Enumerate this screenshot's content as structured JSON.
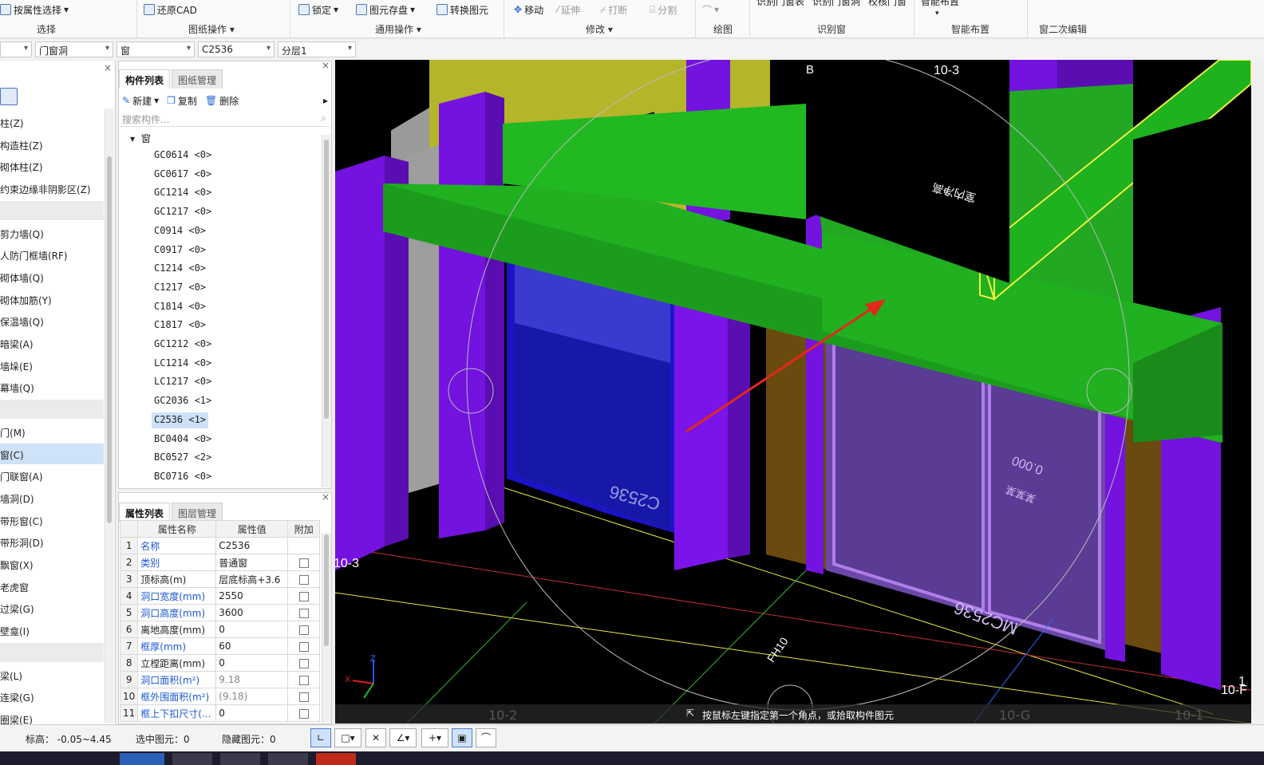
{
  "ribbon": {
    "select": {
      "btn": "按属性选择",
      "label": "选择"
    },
    "drawing_ops": {
      "btn": "还原CAD",
      "label": "图纸操作"
    },
    "common_ops": {
      "lock": "锁定",
      "save": "图元存盘",
      "convert": "转换图元",
      "label": "通用操作"
    },
    "modify": {
      "move": "移动",
      "extend": "延伸",
      "break": "打断",
      "split": "分割",
      "label": "修改"
    },
    "draw": {
      "label": "绘图"
    },
    "recognize": {
      "a": "识别门窗表",
      "b": "识别门窗洞",
      "c": "校核门窗",
      "label": "识别窗"
    },
    "smart": {
      "btn": "智能布置",
      "label": "智能布置"
    },
    "secondary": {
      "label": "窗二次编辑"
    }
  },
  "combos": {
    "c1": "",
    "c2": "门窗洞",
    "c3": "窗",
    "c4": "C2536",
    "c5": "分层1"
  },
  "left_panel": {
    "items": [
      {
        "label": "柱(Z)",
        "sep": false,
        "sel": false
      },
      {
        "label": "构造柱(Z)",
        "sep": false,
        "sel": false
      },
      {
        "label": "砌体柱(Z)",
        "sep": false,
        "sel": false
      },
      {
        "label": "约束边缘非阴影区(Z)",
        "sep": false,
        "sel": false
      },
      {
        "label": "",
        "sep": true,
        "sel": false
      },
      {
        "label": "剪力墙(Q)",
        "sep": false,
        "sel": false
      },
      {
        "label": "人防门框墙(RF)",
        "sep": false,
        "sel": false
      },
      {
        "label": "砌体墙(Q)",
        "sep": false,
        "sel": false
      },
      {
        "label": "砌体加筋(Y)",
        "sep": false,
        "sel": false
      },
      {
        "label": "保温墙(Q)",
        "sep": false,
        "sel": false
      },
      {
        "label": "暗梁(A)",
        "sep": false,
        "sel": false
      },
      {
        "label": "墙垛(E)",
        "sep": false,
        "sel": false
      },
      {
        "label": "幕墙(Q)",
        "sep": false,
        "sel": false
      },
      {
        "label": "",
        "sep": true,
        "sel": false
      },
      {
        "label": "门(M)",
        "sep": false,
        "sel": false
      },
      {
        "label": "窗(C)",
        "sep": false,
        "sel": true
      },
      {
        "label": "门联窗(A)",
        "sep": false,
        "sel": false
      },
      {
        "label": "墙洞(D)",
        "sep": false,
        "sel": false
      },
      {
        "label": "带形窗(C)",
        "sep": false,
        "sel": false
      },
      {
        "label": "带形洞(D)",
        "sep": false,
        "sel": false
      },
      {
        "label": "飘窗(X)",
        "sep": false,
        "sel": false
      },
      {
        "label": "老虎窗",
        "sep": false,
        "sel": false
      },
      {
        "label": "过梁(G)",
        "sep": false,
        "sel": false
      },
      {
        "label": "壁龛(I)",
        "sep": false,
        "sel": false
      },
      {
        "label": "",
        "sep": true,
        "sel": false
      },
      {
        "label": "梁(L)",
        "sep": false,
        "sel": false
      },
      {
        "label": "连梁(G)",
        "sep": false,
        "sel": false
      },
      {
        "label": "圈梁(E)",
        "sep": false,
        "sel": false
      }
    ]
  },
  "component_list": {
    "tab_active": "构件列表",
    "tab_other": "图纸管理",
    "new": "新建",
    "copy": "复制",
    "delete": "删除",
    "search_placeholder": "搜索构件...",
    "root": "窗",
    "items": [
      {
        "label": "GC0614 <0>",
        "sel": false
      },
      {
        "label": "GC0617 <0>",
        "sel": false
      },
      {
        "label": "GC1214 <0>",
        "sel": false
      },
      {
        "label": "GC1217 <0>",
        "sel": false
      },
      {
        "label": "C0914 <0>",
        "sel": false
      },
      {
        "label": "C0917 <0>",
        "sel": false
      },
      {
        "label": "C1214 <0>",
        "sel": false
      },
      {
        "label": "C1217 <0>",
        "sel": false
      },
      {
        "label": "C1814 <0>",
        "sel": false
      },
      {
        "label": "C1817 <0>",
        "sel": false
      },
      {
        "label": "GC1212 <0>",
        "sel": false
      },
      {
        "label": "LC1214 <0>",
        "sel": false
      },
      {
        "label": "LC1217 <0>",
        "sel": false
      },
      {
        "label": "GC2036 <1>",
        "sel": false
      },
      {
        "label": "C2536 <1>",
        "sel": true
      },
      {
        "label": "BC0404 <0>",
        "sel": false
      },
      {
        "label": "BC0527 <2>",
        "sel": false
      },
      {
        "label": "BC0716 <0>",
        "sel": false
      }
    ]
  },
  "properties": {
    "tab_active": "属性列表",
    "tab_other": "图层管理",
    "headers": [
      "属性名称",
      "属性值",
      "附加"
    ],
    "rows": [
      {
        "n": "1",
        "name": "名称",
        "value": "C2536",
        "style": "blue",
        "vstyle": "",
        "cb": false
      },
      {
        "n": "2",
        "name": "类别",
        "value": "普通窗",
        "style": "blue",
        "vstyle": "",
        "cb": true
      },
      {
        "n": "3",
        "name": "顶标高(m)",
        "value": "层底标高+3.6",
        "style": "",
        "vstyle": "",
        "cb": true
      },
      {
        "n": "4",
        "name": "洞口宽度(mm)",
        "value": "2550",
        "style": "blue",
        "vstyle": "",
        "cb": true
      },
      {
        "n": "5",
        "name": "洞口高度(mm)",
        "value": "3600",
        "style": "blue",
        "vstyle": "",
        "cb": true
      },
      {
        "n": "6",
        "name": "离地高度(mm)",
        "value": "0",
        "style": "",
        "vstyle": "",
        "cb": true
      },
      {
        "n": "7",
        "name": "框厚(mm)",
        "value": "60",
        "style": "blue",
        "vstyle": "",
        "cb": true
      },
      {
        "n": "8",
        "name": "立樘距离(mm)",
        "value": "0",
        "style": "",
        "vstyle": "",
        "cb": true
      },
      {
        "n": "9",
        "name": "洞口面积(m²)",
        "value": "9.18",
        "style": "blue",
        "vstyle": "gray",
        "cb": true
      },
      {
        "n": "10",
        "name": "框外围面积(m²)",
        "value": "(9.18)",
        "style": "blue",
        "vstyle": "gray",
        "cb": true
      },
      {
        "n": "11",
        "name": "框上下扣尺寸(...",
        "value": "0",
        "style": "blue",
        "vstyle": "",
        "cb": true
      }
    ]
  },
  "viewport": {
    "labels": {
      "b": "B",
      "axis_top": "10-3",
      "axis_left": "10-3",
      "ceiling_text": "室内净高",
      "window_tag": "C2536",
      "door_tag": "MC2536",
      "level": "0.000",
      "floor_text": "某某某",
      "arrow_text": "FH10",
      "bottom_axes": [
        "10-2",
        "10-G",
        "10-1"
      ],
      "right_axis": "10-F",
      "right_axis2": "1"
    },
    "hint": "按鼠标左键指定第一个角点，或拾取构件图元"
  },
  "status": {
    "elevation": "标高： -0.05~4.45",
    "selected": "选中图元：0",
    "hidden": "隐藏图元：0"
  },
  "colors": {
    "column": "#7a10e6",
    "beam": "#22b222",
    "wall": "#b2b226",
    "window": "#1a12c8",
    "arrow": "#e02a1a"
  }
}
